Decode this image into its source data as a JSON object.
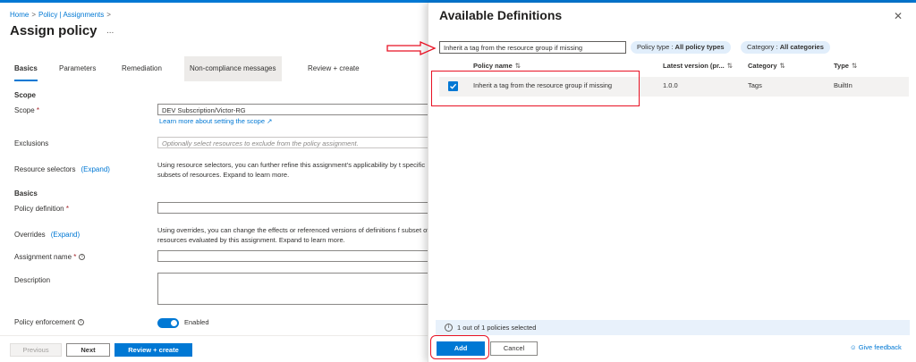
{
  "breadcrumb": {
    "home": "Home",
    "sep1": ">",
    "policy": "Policy | Assignments",
    "sep2": ">"
  },
  "page_title": "Assign policy",
  "more_label": "...",
  "tabs": [
    {
      "label": "Basics"
    },
    {
      "label": "Parameters"
    },
    {
      "label": "Remediation"
    },
    {
      "label": "Non-compliance messages"
    },
    {
      "label": "Review + create"
    }
  ],
  "form": {
    "scope_section": "Scope",
    "scope_label": "Scope",
    "required_mark": "*",
    "scope_value": "DEV Subscription/Victor-RG",
    "scope_link": "Learn more about setting the scope",
    "exclusions_label": "Exclusions",
    "exclusions_placeholder": "Optionally select resources to exclude from the policy assignment.",
    "resource_selectors_label": "Resource selectors",
    "expand_label": "(Expand)",
    "resource_selectors_help": "Using resource selectors, you can further refine this assignment's applicability by t specific subsets of resources. Expand to learn more.",
    "basics_section": "Basics",
    "policy_definition_label": "Policy definition",
    "policy_definition_value": "",
    "overrides_label": "Overrides",
    "overrides_help": "Using overrides, you can change the effects or referenced versions of definitions f subset of resources evaluated by this assignment. Expand to learn more.",
    "assignment_name_label": "Assignment name",
    "assignment_name_value": "",
    "description_label": "Description",
    "description_value": "",
    "enforcement_label": "Policy enforcement",
    "enforcement_value": "Enabled"
  },
  "footer": {
    "previous": "Previous",
    "next": "Next",
    "review": "Review + create"
  },
  "panel": {
    "title": "Available Definitions",
    "close": "✕",
    "search_value": "Inherit a tag from the resource group if missing",
    "filters": [
      {
        "name": "Policy type : ",
        "value": "All policy types"
      },
      {
        "name": "Category : ",
        "value": "All categories"
      }
    ],
    "columns": [
      "Policy name",
      "Latest version (pr...",
      "Category",
      "Type"
    ],
    "rows": [
      {
        "policy_name": "Inherit a tag from the resource group if missing",
        "version": "1.0.0",
        "category": "Tags",
        "type": "BuiltIn",
        "selected": true
      }
    ],
    "status": "1 out of 1 policies selected",
    "add": "Add",
    "cancel": "Cancel",
    "feedback": "Give feedback"
  },
  "colors": {
    "accent": "#0078d4",
    "highlight": "#e81123"
  }
}
